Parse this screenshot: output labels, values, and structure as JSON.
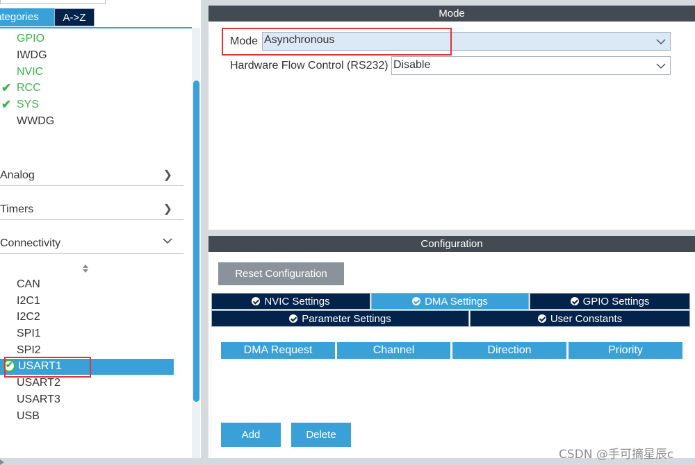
{
  "left_panel": {
    "tabs": [
      {
        "label": "ategories"
      },
      {
        "label": "A->Z"
      }
    ],
    "system_core_items": [
      {
        "label": "GPIO"
      },
      {
        "label": "IWDG"
      },
      {
        "label": "NVIC"
      },
      {
        "label": "RCC"
      },
      {
        "label": "SYS"
      },
      {
        "label": "WWDG"
      }
    ],
    "categories": [
      {
        "label": "Analog"
      },
      {
        "label": "Timers"
      },
      {
        "label": "Connectivity"
      }
    ],
    "connectivity_items": [
      {
        "label": "CAN"
      },
      {
        "label": "I2C1"
      },
      {
        "label": "I2C2"
      },
      {
        "label": "SPI1"
      },
      {
        "label": "SPI2"
      },
      {
        "label": "USART1"
      },
      {
        "label": "USART2"
      },
      {
        "label": "USART3"
      },
      {
        "label": "USB"
      }
    ]
  },
  "mode_section": {
    "title": "Mode",
    "mode_label": "Mode",
    "mode_value": "Asynchronous",
    "hfc_label": "Hardware Flow Control (RS232)",
    "hfc_value": "Disable"
  },
  "configuration": {
    "title": "Configuration",
    "reset_label": "Reset Configuration",
    "tabs_row1": [
      {
        "label": "NVIC Settings"
      },
      {
        "label": "DMA Settings"
      },
      {
        "label": "GPIO Settings"
      }
    ],
    "tabs_row2": [
      {
        "label": "Parameter Settings"
      },
      {
        "label": "User Constants"
      }
    ],
    "table_headers": [
      "DMA Request",
      "Channel",
      "Direction",
      "Priority"
    ],
    "add_label": "Add",
    "delete_label": "Delete"
  },
  "watermark": "CSDN @手可摘星辰c",
  "colors": {
    "accent": "#39a1d8",
    "navy": "#03234b",
    "header": "#434a52",
    "ok_green": "#3bb44a",
    "highlight_red": "#e0333a"
  }
}
